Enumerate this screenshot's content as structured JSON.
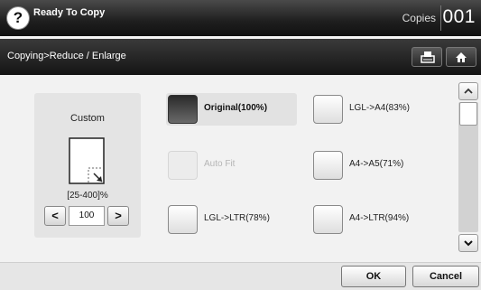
{
  "header": {
    "help_symbol": "?",
    "title": "Ready To Copy",
    "copies_label": "Copies",
    "copies_count": "001"
  },
  "breadcrumb": {
    "path": "Copying>Reduce / Enlarge",
    "icons": [
      "tray-icon",
      "home-icon"
    ]
  },
  "custom": {
    "title": "Custom",
    "range": "[25-400]%",
    "value": "100",
    "decrement_symbol": "<",
    "increment_symbol": ">"
  },
  "options": [
    {
      "label": "Original(100%)",
      "state": "selected"
    },
    {
      "label": "Auto Fit",
      "state": "disabled"
    },
    {
      "label": "LGL->LTR(78%)",
      "state": "normal"
    },
    {
      "label": "LGL->A4(83%)",
      "state": "normal"
    },
    {
      "label": "A4->A5(71%)",
      "state": "normal"
    },
    {
      "label": "A4->LTR(94%)",
      "state": "normal"
    }
  ],
  "footer": {
    "ok_label": "OK",
    "cancel_label": "Cancel"
  },
  "colors": {
    "header_bg": "#1e1e1e",
    "selected_option": "#3a3a3a",
    "disabled_text": "#b5b5b5"
  }
}
